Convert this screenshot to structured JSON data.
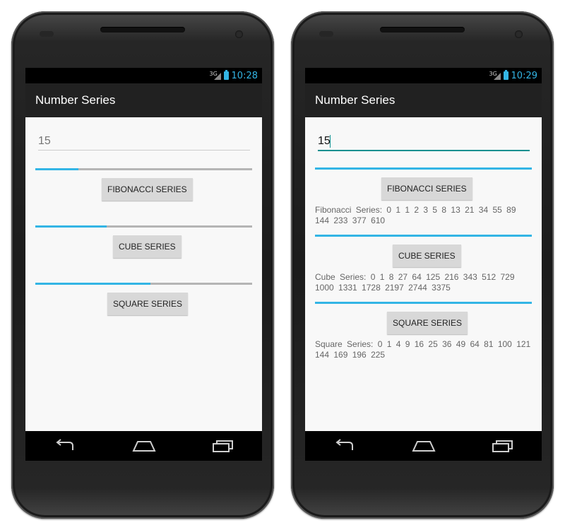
{
  "colors": {
    "accent": "#33b5e5",
    "appbar": "#212121",
    "content": "#f8f8f8",
    "input_underline_active": "#0a8f8f"
  },
  "left_screen": {
    "status": {
      "network": "3G",
      "time": "10:28"
    },
    "app_title": "Number Series",
    "input": {
      "value": "",
      "placeholder": "15"
    },
    "seekbars": [
      0.2,
      0.33,
      0.53
    ],
    "buttons": {
      "fibonacci": "FIBONACCI SERIES",
      "cube": "CUBE SERIES",
      "square": "SQUARE SERIES"
    },
    "nav_icons": [
      "back-icon",
      "home-icon",
      "recent-apps-icon"
    ]
  },
  "right_screen": {
    "status": {
      "network": "3G",
      "time": "10:29"
    },
    "app_title": "Number Series",
    "input": {
      "value": "15",
      "placeholder": ""
    },
    "seekbars": [
      1.0,
      1.0,
      1.0
    ],
    "buttons": {
      "fibonacci": "FIBONACCI SERIES",
      "cube": "CUBE SERIES",
      "square": "SQUARE SERIES"
    },
    "results": {
      "fibonacci": "Fibonacci Series: 0 1  1  2  3  5  8  13  21  34  55  89  144  233  377  610",
      "cube": "Cube Series: 0 1  8  27  64  125  216  343  512  729  1000  1331  1728  2197  2744  3375",
      "square": "Square Series: 0 1  4  9  16  25  36  49  64  81  100  121  144  169  196  225"
    },
    "nav_icons": [
      "back-icon",
      "home-icon",
      "recent-apps-icon"
    ]
  }
}
